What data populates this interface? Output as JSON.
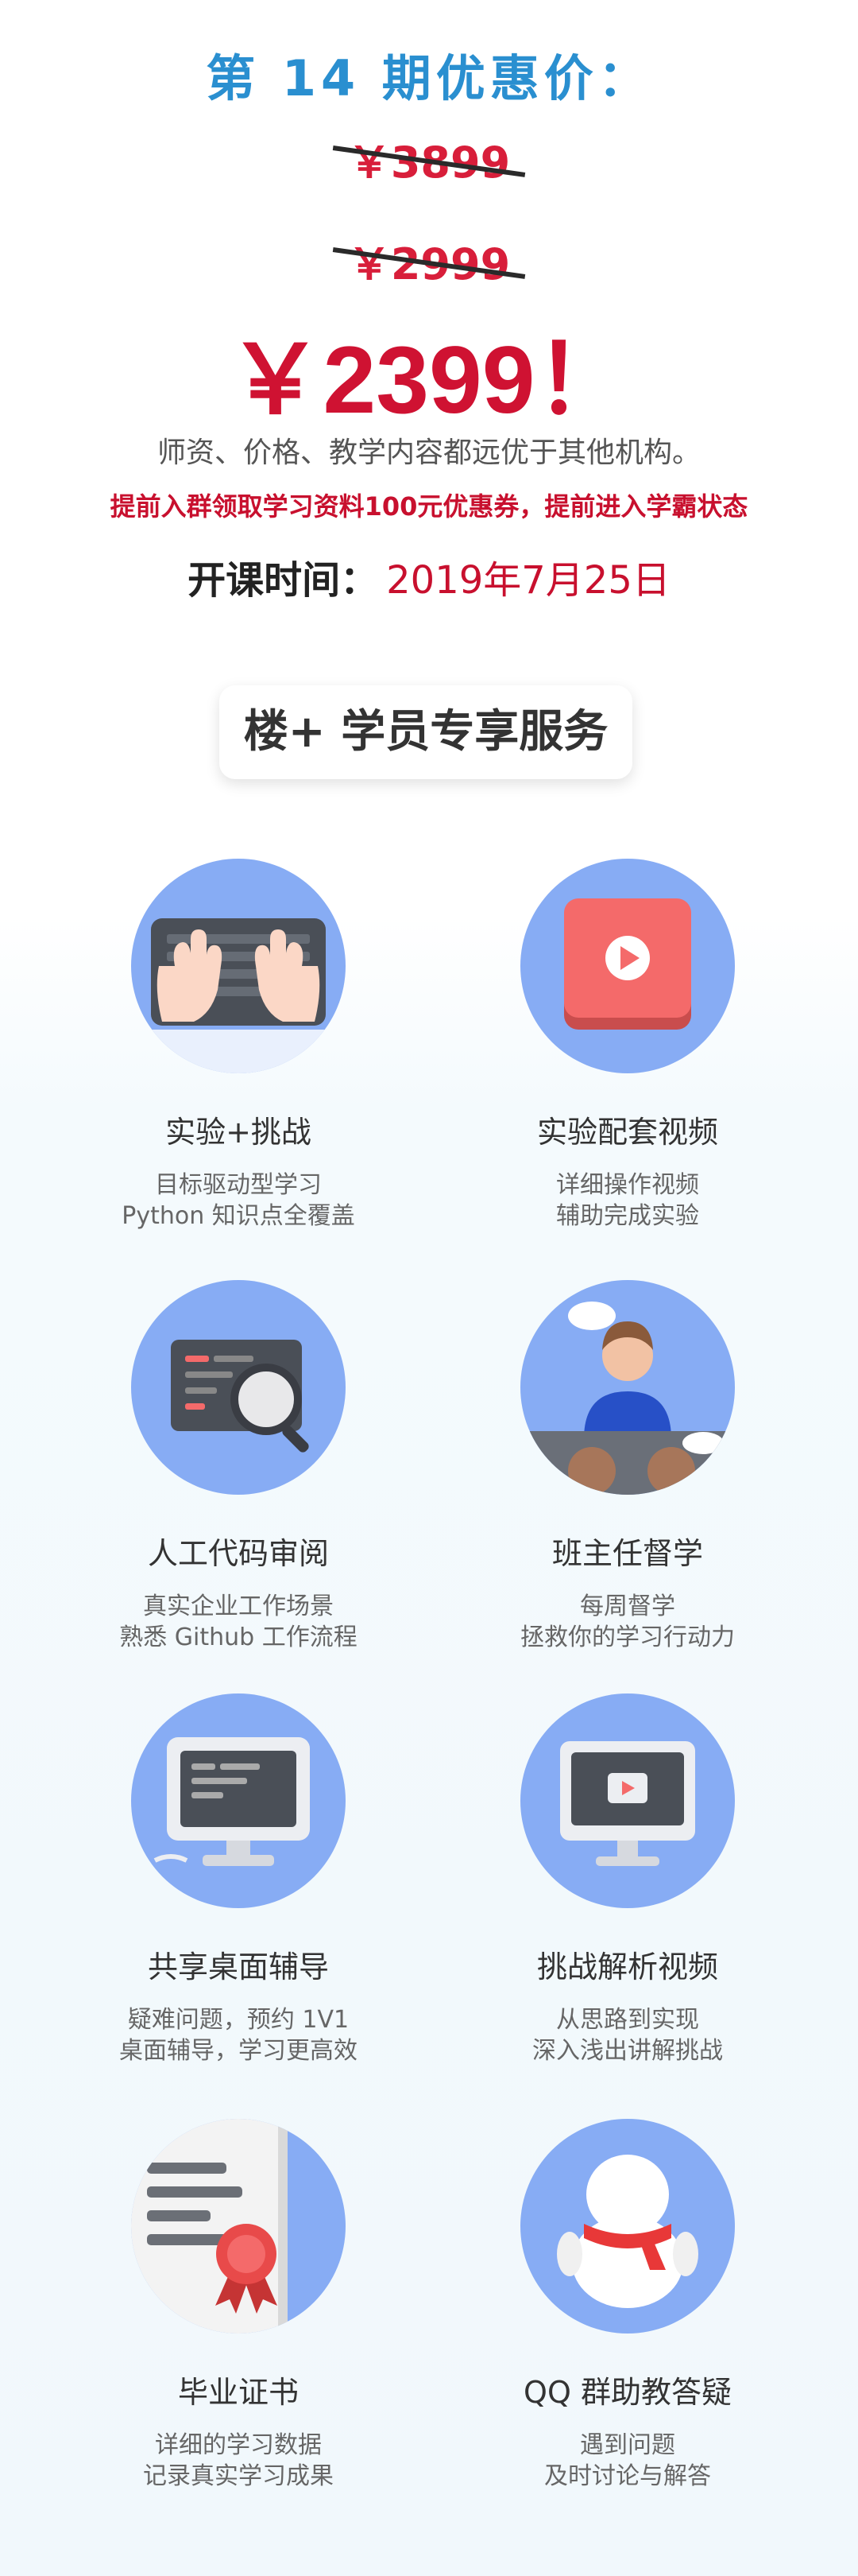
{
  "header": {
    "title": "第 14 期优惠价：",
    "old_price_1": "￥3899",
    "old_price_2": "￥2999",
    "current_price": "￥2399！",
    "description": "师资、价格、教学内容都远优于其他机构。",
    "promo": "提前入群领取学习资料100元优惠券，提前进入学霸状态",
    "date_label": "开课时间：",
    "date_value": "2019年7月25日"
  },
  "services": {
    "title": "楼+ 学员专享服务",
    "items": [
      {
        "title": "实验+挑战",
        "line1": "目标驱动型学习",
        "line2": "Python 知识点全覆盖",
        "icon": "keyboard-icon"
      },
      {
        "title": "实验配套视频",
        "line1": "详细操作视频",
        "line2": "辅助完成实验",
        "icon": "video-play-icon"
      },
      {
        "title": "人工代码审阅",
        "line1": "真实企业工作场景",
        "line2": "熟悉 Github 工作流程",
        "icon": "code-review-icon"
      },
      {
        "title": "班主任督学",
        "line1": "每周督学",
        "line2": "拯救你的学习行动力",
        "icon": "teacher-icon"
      },
      {
        "title": "共享桌面辅导",
        "line1": "疑难问题，预约 1V1",
        "line2": "桌面辅导，学习更高效",
        "icon": "desktop-icon"
      },
      {
        "title": "挑战解析视频",
        "line1": "从思路到实现",
        "line2": "深入浅出讲解挑战",
        "icon": "monitor-video-icon"
      },
      {
        "title": "毕业证书",
        "line1": "详细的学习数据",
        "line2": "记录真实学习成果",
        "icon": "certificate-icon"
      },
      {
        "title": "QQ 群助教答疑",
        "line1": "遇到问题",
        "line2": "及时讨论与解答",
        "icon": "qq-penguin-icon"
      }
    ]
  },
  "colors": {
    "title_blue": "#2a8fd0",
    "price_red": "#cf1232",
    "icon_circle": "#87acf4"
  }
}
